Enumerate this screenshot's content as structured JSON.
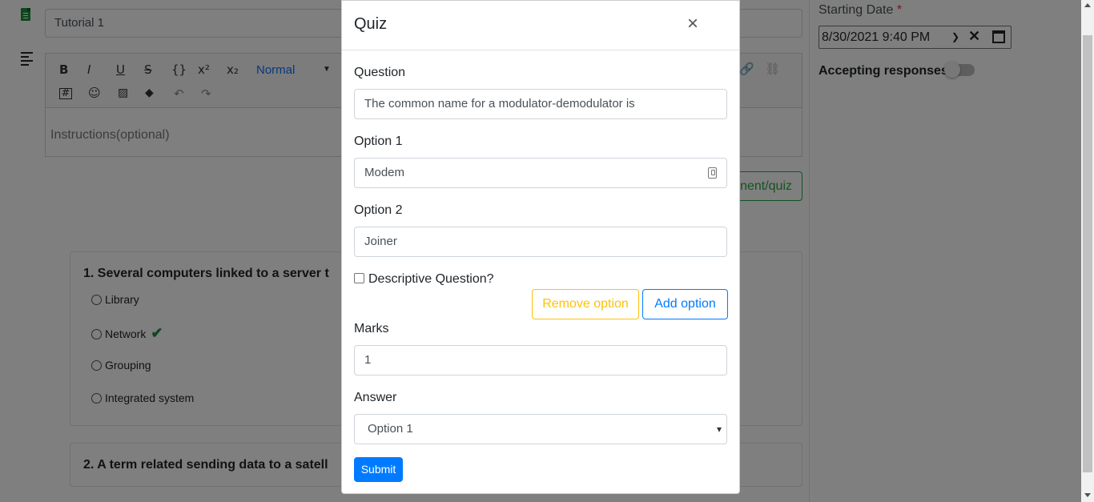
{
  "background": {
    "title_input_value": "Tutorial 1",
    "editor": {
      "toolbar": {
        "bold": "B",
        "italic": "I",
        "underline": "U",
        "strike": "S",
        "code": "{}",
        "superscript": "x²",
        "subscript": "x₂",
        "heading_select": "Normal"
      },
      "placeholder": "Instructions(optional)"
    },
    "create_button_label": "nent/quiz",
    "starting_date": {
      "label": "Starting Date",
      "required_mark": "*",
      "value": "8/30/2021  9:40   PM"
    },
    "accepting_responses_label": "Accepting responses",
    "questions": [
      {
        "title": "1. Several computers linked to a server t",
        "options": [
          "Library",
          "Network",
          "Grouping",
          "Integrated system"
        ],
        "correct_index": 1
      },
      {
        "title": "2. A term related sending data to a satell"
      }
    ]
  },
  "modal": {
    "title": "Quiz",
    "close_symbol": "×",
    "question_label": "Question",
    "question_value": "The common name for a modulator-demodulator is",
    "option1_label": "Option 1",
    "option1_value": "Modem",
    "option2_label": "Option 2",
    "option2_value": "Joiner",
    "descriptive_label": "Descriptive Question?",
    "remove_option_label": "Remove option",
    "add_option_label": "Add option",
    "marks_label": "Marks",
    "marks_value": "1",
    "answer_label": "Answer",
    "answer_selected": "Option 1",
    "submit_label": "Submit"
  },
  "colors": {
    "primary": "#007bff",
    "warning": "#ffc107",
    "success": "#28a745",
    "danger": "#dc3545"
  }
}
